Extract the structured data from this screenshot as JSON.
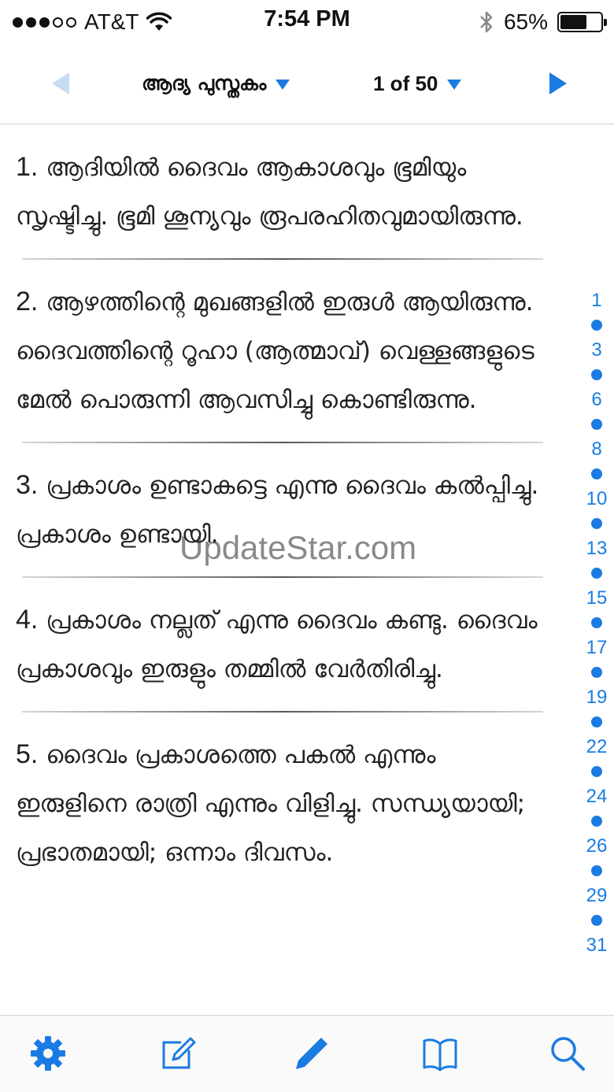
{
  "status_bar": {
    "carrier": "AT&T",
    "time": "7:54 PM",
    "battery_percent": "65%",
    "battery_level": 0.65,
    "signal_bars_filled": 3,
    "signal_bars_total": 5
  },
  "nav": {
    "book_title": "ആദ്യ പുസ്തകം",
    "chapter_label": "1 of 50",
    "accent_color": "#1a7ce2",
    "prev_icon": "chevron-left-icon",
    "next_icon": "chevron-right-icon"
  },
  "verses": [
    {
      "num": "1.",
      "text": "ആദിയിൽ ദൈവം ആകാശവും ഭൂമിയും സൃഷ്ടിച്ചു. ഭൂമി ശൂന്യവും രൂപരഹിതവുമായിരുന്നു."
    },
    {
      "num": "2.",
      "text": "ആഴത്തിന്റെ മുഖങ്ങളിൽ ഇരുൾ ആയിരുന്നു. ദൈവത്തിന്റെ റൂഹാ (ആത്മാവ്) വെള്ളങ്ങളുടെ മേൽ പൊരുന്നി ആവസിച്ചു കൊണ്ടിരുന്നു."
    },
    {
      "num": "3.",
      "text": "പ്രകാശം ഉണ്ടാകട്ടെ എന്നു ദൈവം കൽപ്പിച്ചു. പ്രകാശം ഉണ്ടായി."
    },
    {
      "num": "4.",
      "text": "പ്രകാശം നല്ലത് എന്നു ദൈവം കണ്ടു. ദൈവം പ്രകാശവും ഇരുളും തമ്മിൽ വേർതിരിച്ചു."
    },
    {
      "num": "5.",
      "text": "ദൈവം പ്രകാശത്തെ പകൽ എന്നും ഇരുളിനെ രാത്രി എന്നും വിളിച്ചു. സന്ധ്യയായി; പ്രഭാതമായി; ഒന്നാം ദിവസം."
    }
  ],
  "watermark": "UpdateStar.com",
  "verse_index": [
    "1",
    "3",
    "6",
    "8",
    "10",
    "13",
    "15",
    "17",
    "19",
    "22",
    "24",
    "26",
    "29",
    "31"
  ],
  "tab_bar": {
    "items": [
      {
        "icon": "gear-icon"
      },
      {
        "icon": "edit-note-icon"
      },
      {
        "icon": "pencil-icon"
      },
      {
        "icon": "book-icon"
      },
      {
        "icon": "search-icon"
      }
    ]
  }
}
